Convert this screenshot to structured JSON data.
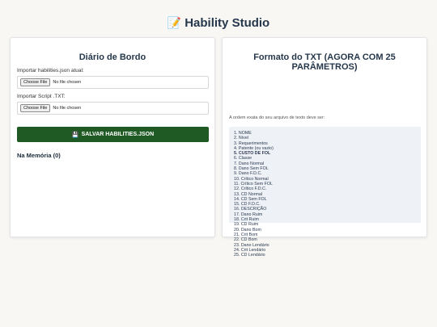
{
  "app": {
    "title": "Hability Studio",
    "title_icon": "📝"
  },
  "left_panel": {
    "heading": "Diário de Bordo",
    "import_json_label": "Importar habilities.json atual:",
    "import_txt_label": "Importar Script .TXT:",
    "file_button_label": "Choose File",
    "file_status": "No file chosen",
    "save_button_label": "SALVAR HABILITIES.JSON",
    "save_icon": "💾",
    "memory_label": "Na Memória (0)",
    "save_button_color": "#1f5a24"
  },
  "right_panel": {
    "heading": "Formato do TXT (AGORA COM 25 PARÂMETROS)",
    "intro": "A ordem exata do seu arquivo de texto deve ser:",
    "items": [
      "1. NOME",
      "2. Nível",
      "3. Requerimentos",
      "4. Patente (ou vazio)",
      "5. CUSTO DE FOL",
      "6. Classe",
      "7. Dano Normal",
      "8. Dano Sem FOL",
      "9. Dano F.D.C.",
      "10. Crítico Normal",
      "11. Crítico Sem FOL",
      "12. Crítico F.D.C.",
      "13. CD Normal",
      "14. CD Sem FOL",
      "15. CD F.D.C.",
      "16. DESCRIÇÃO",
      "17. Dano Ruim",
      "18. Crit Ruim",
      "19. CD Ruim",
      "20. Dano Bom",
      "21. Crit Bom",
      "22. CD Bom",
      "23. Dano Lendário",
      "24. Crit Lendário",
      "25. CD Lendário"
    ],
    "bold_item_index": 4
  }
}
